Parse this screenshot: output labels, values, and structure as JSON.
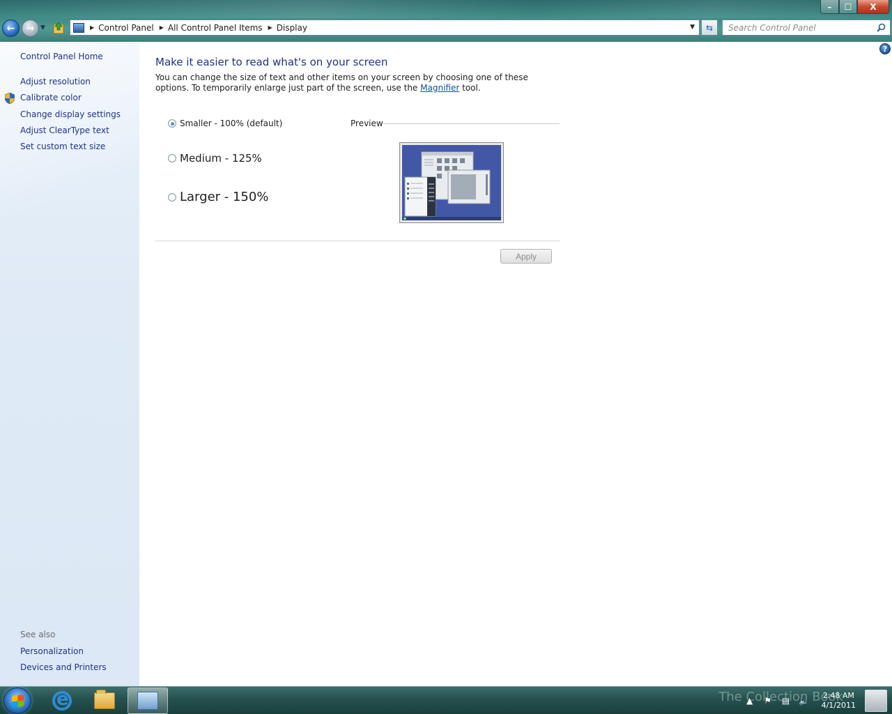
{
  "window": {
    "min_symbol": "–",
    "max_symbol": "☐",
    "close_symbol": "X"
  },
  "address": {
    "breadcrumbs": [
      "Control Panel",
      "All Control Panel Items",
      "Display"
    ]
  },
  "search": {
    "placeholder": "Search Control Panel"
  },
  "sidebar": {
    "home": "Control Panel Home",
    "items": [
      {
        "label": "Adjust resolution"
      },
      {
        "label": "Calibrate color"
      },
      {
        "label": "Change display settings"
      },
      {
        "label": "Adjust ClearType text"
      },
      {
        "label": "Set custom text size"
      }
    ],
    "see_also_label": "See also",
    "see_also_items": [
      {
        "label": "Personalization"
      },
      {
        "label": "Devices and Printers"
      }
    ]
  },
  "main": {
    "title": "Make it easier to read what's on your screen",
    "desc_part1": "You can change the size of text and other items on your screen by choosing one of these options. To temporarily enlarge just part of the screen, use the ",
    "desc_link": "Magnifier",
    "desc_part2": " tool.",
    "options": [
      {
        "label": "Smaller - 100% (default)",
        "checked": true
      },
      {
        "label": "Medium - 125%",
        "checked": false
      },
      {
        "label": "Larger - 150%",
        "checked": false
      }
    ],
    "preview_label": "Preview",
    "apply_label": "Apply",
    "help_symbol": "?"
  },
  "taskbar": {
    "time": "2:48 AM",
    "date": "4/1/2011",
    "watermark": "The Collection Book"
  }
}
